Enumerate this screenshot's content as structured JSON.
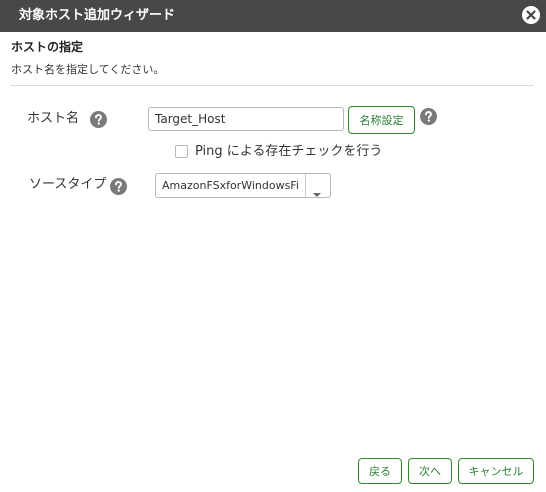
{
  "window": {
    "title": "対象ホスト追加ウィザード"
  },
  "section": {
    "title": "ホストの指定",
    "description": "ホスト名を指定してください。"
  },
  "form": {
    "host_label": "ホスト名",
    "host_value": "Target_Host",
    "name_setting_label": "名称設定",
    "ping_check_label": "Ping による存在チェックを行う",
    "ping_checked": false,
    "source_type_label": "ソースタイプ",
    "source_type_value": "AmazonFSxforWindowsFi"
  },
  "footer": {
    "back_label": "戻る",
    "next_label": "次へ",
    "cancel_label": "キャンセル"
  },
  "colors": {
    "titlebar": "#484848",
    "accent_green": "#2e8b2e",
    "help_icon": "#7a7a7a"
  }
}
